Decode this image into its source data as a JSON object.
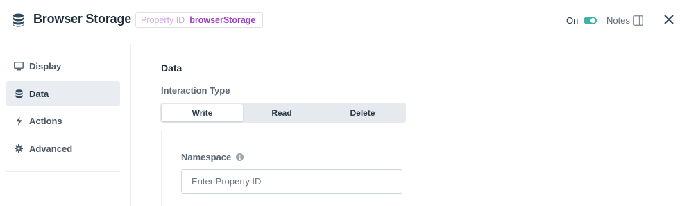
{
  "header": {
    "title": "Browser Storage",
    "property_key": "Property ID",
    "property_value": "browserStorage",
    "on_label": "On",
    "toggle_on": true,
    "notes_label": "Notes"
  },
  "sidebar": {
    "items": [
      {
        "label": "Display",
        "icon": "monitor-icon",
        "active": false
      },
      {
        "label": "Data",
        "icon": "database-icon",
        "active": true
      },
      {
        "label": "Actions",
        "icon": "lightning-icon",
        "active": false
      },
      {
        "label": "Advanced",
        "icon": "gear-icon",
        "active": false
      }
    ]
  },
  "main": {
    "section_title": "Data",
    "interaction_label": "Interaction Type",
    "interaction_options": [
      "Write",
      "Read",
      "Delete"
    ],
    "interaction_selected": "Write",
    "namespace_label": "Namespace",
    "namespace_placeholder": "Enter Property ID",
    "namespace_value": ""
  },
  "colors": {
    "accent_toggle": "#3fb2a8",
    "property_value": "#9b3ec0",
    "property_key": "#d4a5e0",
    "active_nav_bg": "#e9edf1"
  }
}
